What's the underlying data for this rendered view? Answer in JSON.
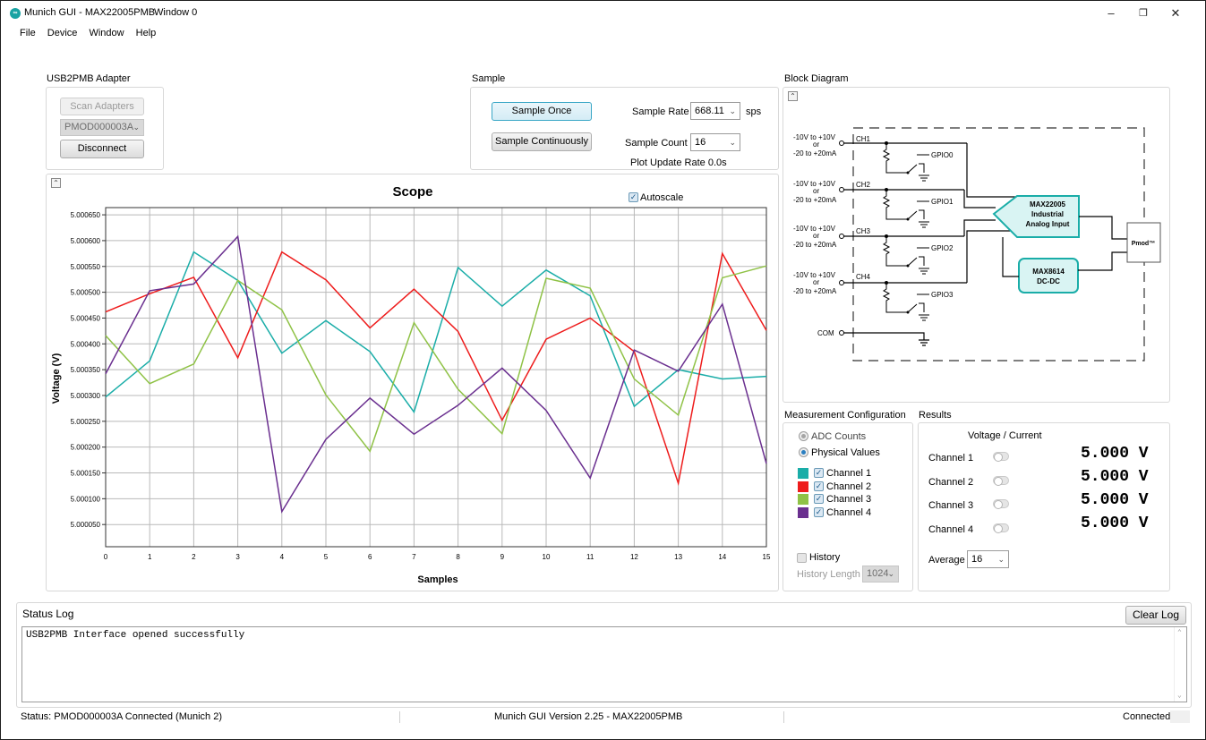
{
  "window": {
    "app_title": "Munich GUI - MAX22005PMB",
    "window_name": "Window 0",
    "icon_text": "∞",
    "minimize": "–",
    "restore": "❐",
    "close": "✕"
  },
  "menu": [
    "File",
    "Device",
    "Window",
    "Help"
  ],
  "adapter": {
    "title": "USB2PMB Adapter",
    "scan_label": "Scan Adapters",
    "selected": "PMOD000003A",
    "disconnect_label": "Disconnect"
  },
  "sample": {
    "title": "Sample",
    "once_label": "Sample Once",
    "continuous_label": "Sample Continuously",
    "rate_label": "Sample Rate",
    "rate_value": "668.11",
    "rate_unit": "sps",
    "count_label": "Sample Count",
    "count_value": "16",
    "update_rate": "Plot Update Rate 0.0s"
  },
  "block_diagram": {
    "title": "Block Diagram",
    "range_line1": "-10V to +10V",
    "range_line2": "or",
    "range_line3": "-20 to  +20mA",
    "channels": [
      "CH1",
      "CH2",
      "CH3",
      "CH4"
    ],
    "gpios": [
      "GPIO0",
      "GPIO1",
      "GPIO2",
      "GPIO3"
    ],
    "com_label": "COM",
    "chip_line1": "MAX22005",
    "chip_line2": "Industrial",
    "chip_line3": "Analog Input",
    "dcdc_line1": "MAX8614",
    "dcdc_line2": "DC-DC",
    "pmod_label": "Pmod™",
    "collapse_icon": "⌃"
  },
  "scope": {
    "collapse_icon": "⌃",
    "autoscale_label": "Autoscale",
    "check_mark": "✓"
  },
  "chart_data": {
    "type": "line",
    "title": "Scope",
    "xlabel": "Samples",
    "ylabel": "Voltage (V)",
    "x": [
      0,
      1,
      2,
      3,
      4,
      5,
      6,
      7,
      8,
      9,
      10,
      11,
      12,
      13,
      14,
      15
    ],
    "xlim": [
      0,
      15
    ],
    "ylim": [
      5.000007,
      5.000664
    ],
    "yticks": [
      "5.000050",
      "5.000100",
      "5.000150",
      "5.000200",
      "5.000250",
      "5.000300",
      "5.000350",
      "5.000400",
      "5.000450",
      "5.000500",
      "5.000550",
      "5.000600",
      "5.000650"
    ],
    "grid": true,
    "series": [
      {
        "name": "Channel 1",
        "color": "#1aada8",
        "values": [
          5.000297,
          5.000367,
          5.000578,
          5.000523,
          5.000382,
          5.000445,
          5.000385,
          5.000268,
          5.000548,
          5.000473,
          5.000543,
          5.000493,
          5.000279,
          5.00035,
          5.000332,
          5.000337
        ]
      },
      {
        "name": "Channel 2",
        "color": "#ee1c1c",
        "values": [
          5.000462,
          5.000497,
          5.000529,
          5.000373,
          5.000578,
          5.000524,
          5.000431,
          5.000506,
          5.000424,
          5.000252,
          5.000409,
          5.00045,
          5.000385,
          5.00013,
          5.000575,
          5.000426
        ]
      },
      {
        "name": "Channel 3",
        "color": "#8fc246",
        "values": [
          5.000416,
          5.000323,
          5.000361,
          5.000523,
          5.000466,
          5.000301,
          5.000192,
          5.000441,
          5.000312,
          5.000226,
          5.000527,
          5.000508,
          5.000332,
          5.000262,
          5.000528,
          5.000551
        ]
      },
      {
        "name": "Channel 4",
        "color": "#6a2f8f",
        "values": [
          5.000342,
          5.000503,
          5.000516,
          5.000608,
          5.000075,
          5.000215,
          5.000295,
          5.000225,
          5.000281,
          5.000353,
          5.000271,
          5.00014,
          5.000388,
          5.000347,
          5.000477,
          5.000168
        ]
      }
    ]
  },
  "measurement": {
    "title": "Measurement Configuration",
    "adc_label": "ADC Counts",
    "physical_label": "Physical Values",
    "channels": [
      "Channel 1",
      "Channel 2",
      "Channel 3",
      "Channel 4"
    ],
    "history_label": "History",
    "history_length_label": "History Length",
    "history_length_value": "1024"
  },
  "results": {
    "title": "Results",
    "header": "Voltage / Current",
    "channels": [
      "Channel 1",
      "Channel 2",
      "Channel 3",
      "Channel 4"
    ],
    "values": [
      "5.000 V",
      "5.000 V",
      "5.000 V",
      "5.000 V"
    ],
    "average_label": "Average",
    "average_value": "16"
  },
  "status_log": {
    "title": "Status Log",
    "clear_label": "Clear Log",
    "text": "USB2PMB Interface opened successfully"
  },
  "statusbar": {
    "left": "Status: PMOD000003A Connected (Munich 2)",
    "center": "Munich GUI Version 2.25 - MAX22005PMB",
    "right": "Connected"
  }
}
